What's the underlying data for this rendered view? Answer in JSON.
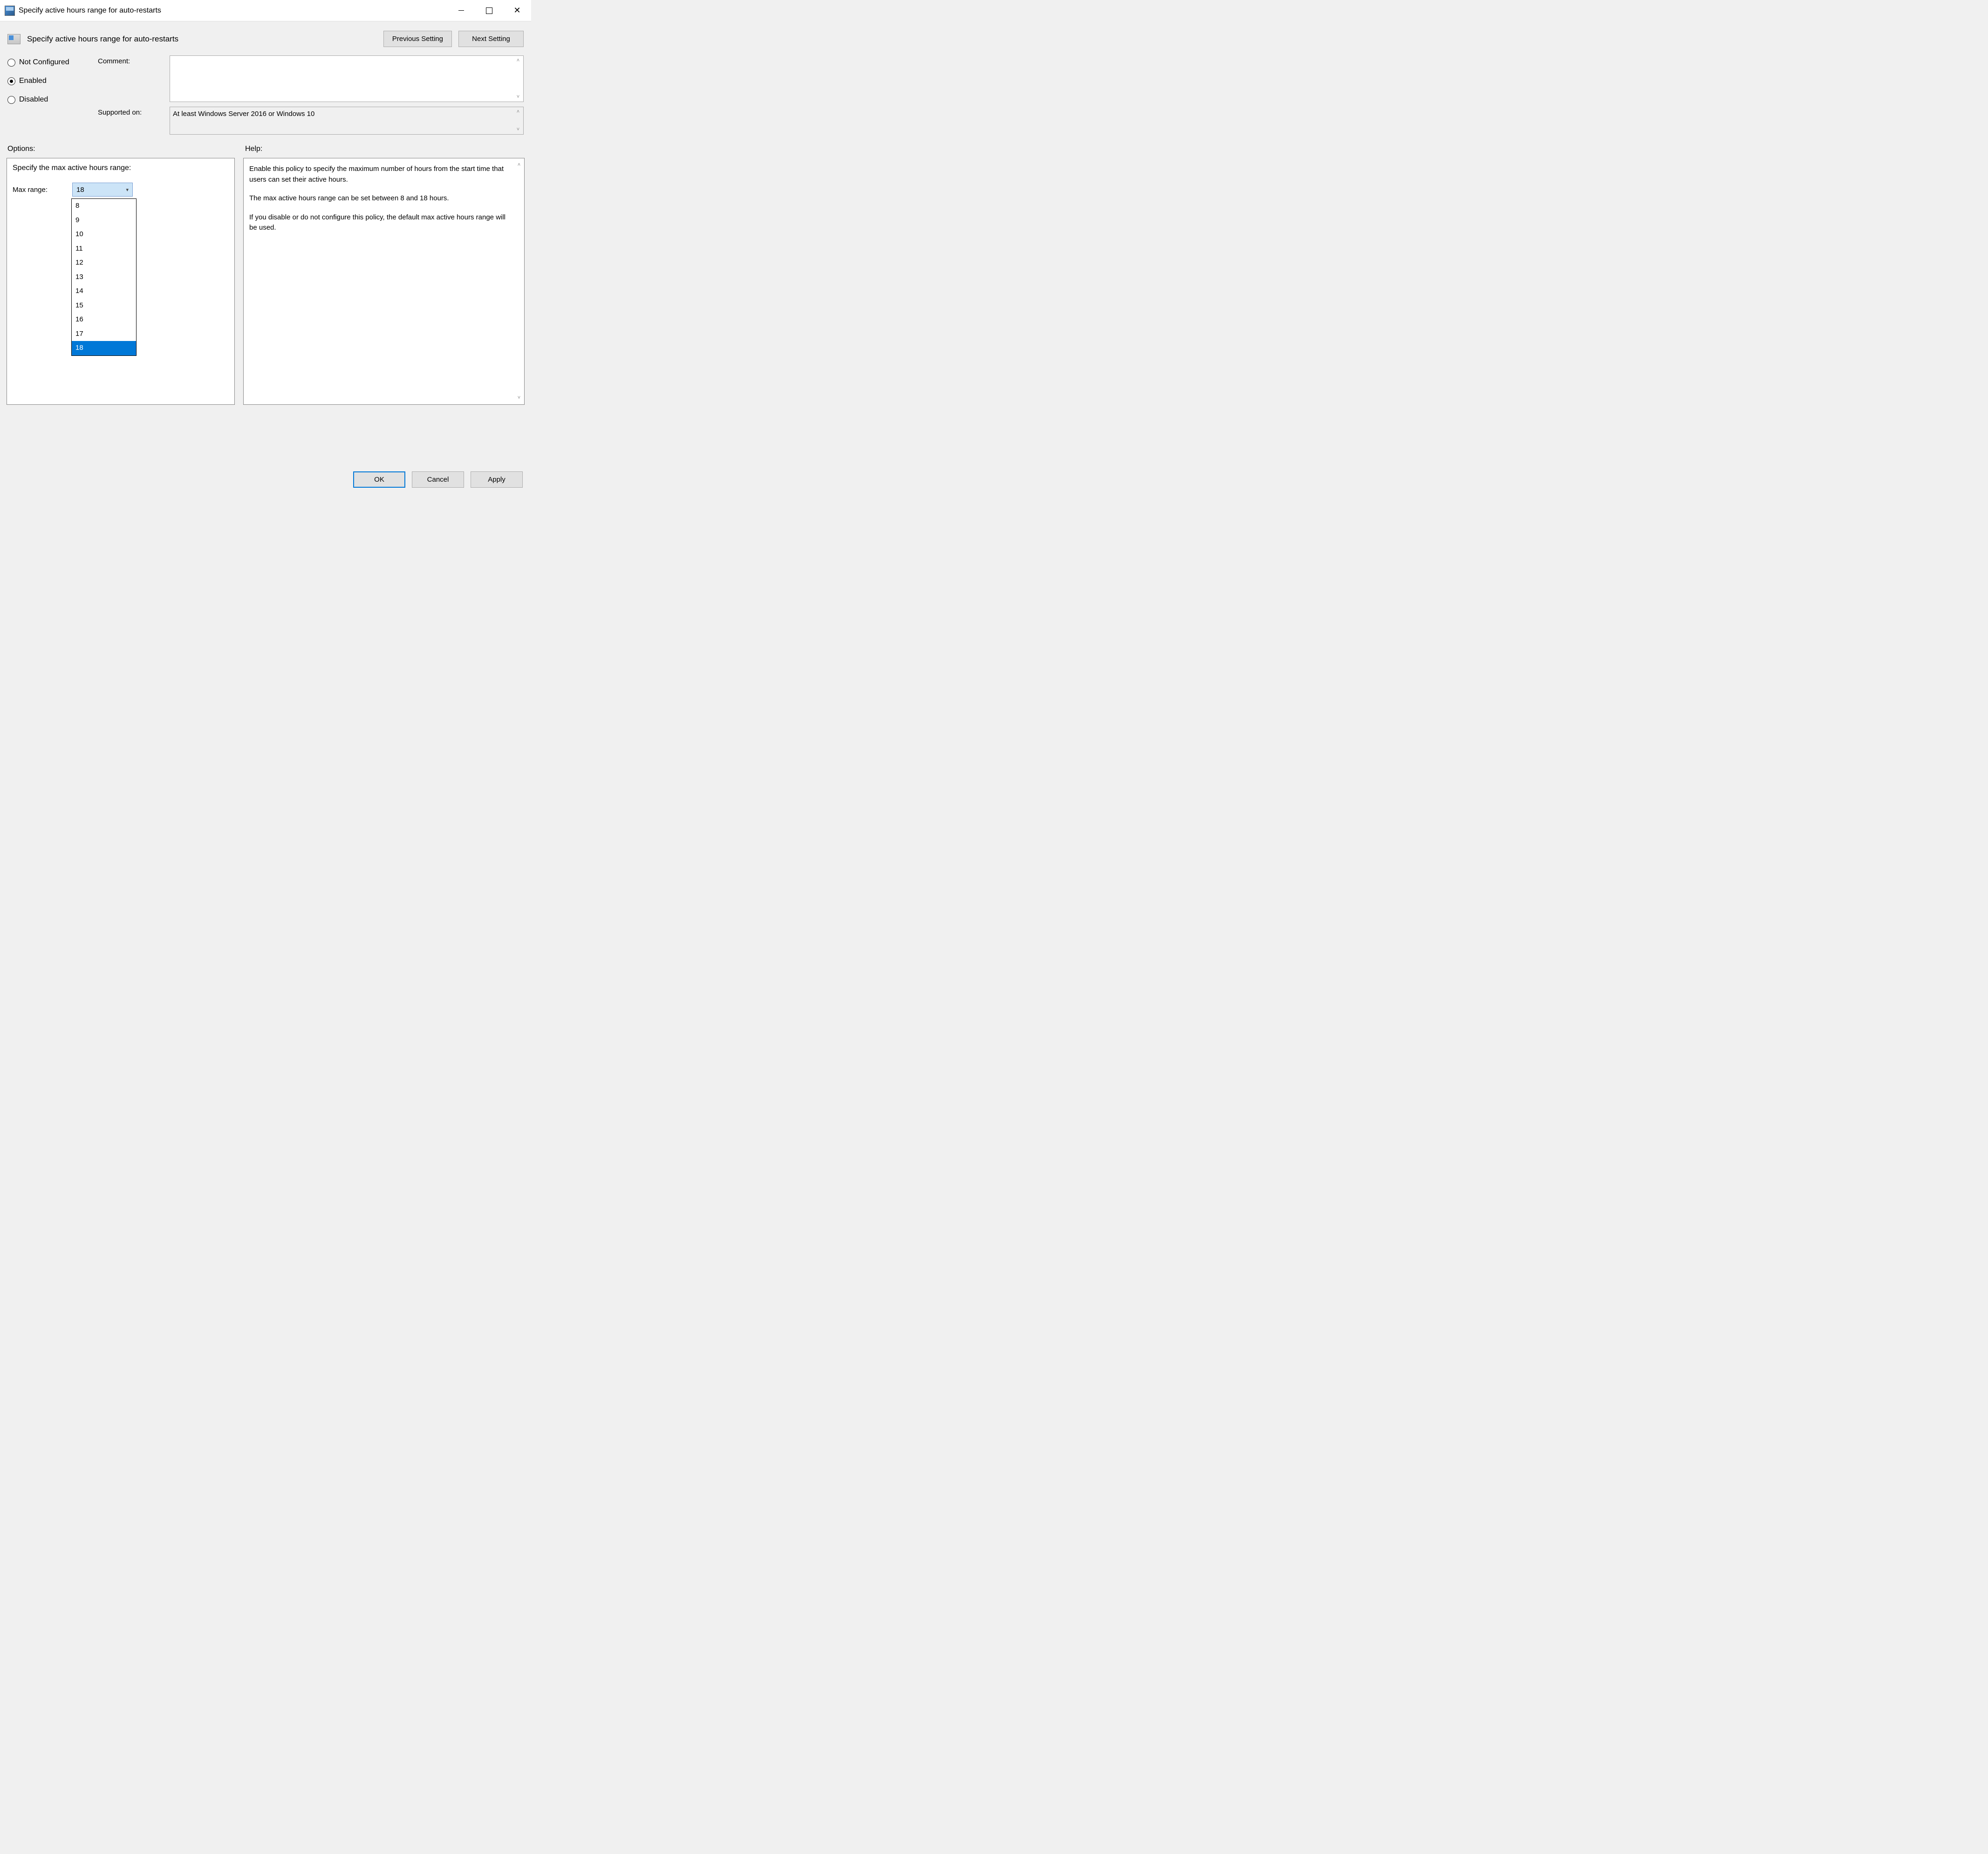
{
  "window": {
    "title": "Specify active hours range for auto-restarts"
  },
  "header": {
    "title": "Specify active hours range for auto-restarts",
    "prev": "Previous Setting",
    "next": "Next Setting"
  },
  "radios": {
    "not_configured": "Not Configured",
    "enabled": "Enabled",
    "disabled": "Disabled",
    "selected": "enabled"
  },
  "fields": {
    "comment_label": "Comment:",
    "comment_value": "",
    "supported_label": "Supported on:",
    "supported_value": "At least Windows Server 2016 or Windows 10"
  },
  "labels": {
    "options": "Options:",
    "help": "Help:"
  },
  "options": {
    "title": "Specify the max active hours range:",
    "max_range_label": "Max range:",
    "max_range_value": "18",
    "dropdown_items": [
      "8",
      "9",
      "10",
      "11",
      "12",
      "13",
      "14",
      "15",
      "16",
      "17",
      "18"
    ],
    "dropdown_selected": "18"
  },
  "help": {
    "p1": "Enable this policy to specify the maximum number of hours from the start time that users can set their active hours.",
    "p2": "The max active hours range can be set between 8 and 18 hours.",
    "p3": "If you disable or do not configure this policy, the default max active hours range will be used."
  },
  "footer": {
    "ok": "OK",
    "cancel": "Cancel",
    "apply": "Apply"
  }
}
